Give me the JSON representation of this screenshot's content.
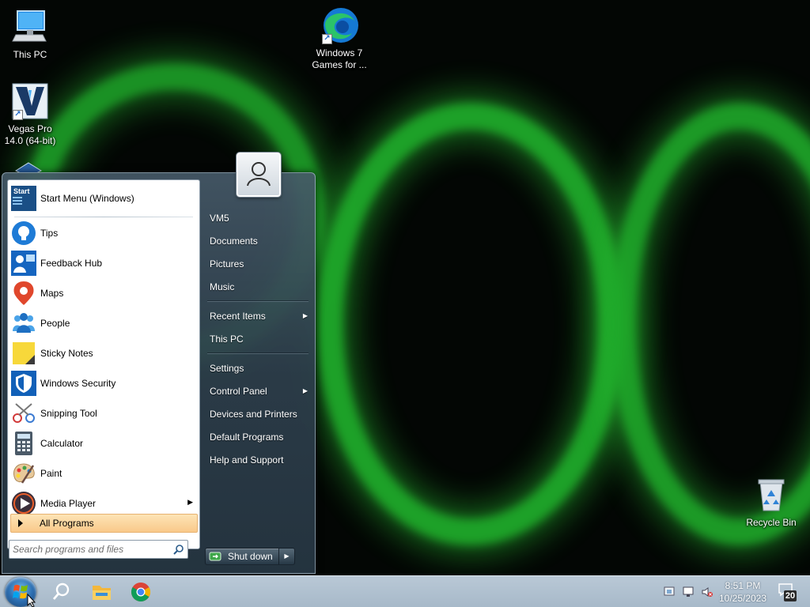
{
  "desktop": {
    "icons": [
      {
        "label": "This PC",
        "icon": "computer-icon"
      },
      {
        "label": "Windows 7 Games for ...",
        "icon": "edge-icon"
      },
      {
        "label": "Vegas Pro 14.0 (64-bit)",
        "icon": "vegas-icon"
      },
      {
        "label": "Recycle Bin",
        "icon": "recycle-bin-icon"
      }
    ]
  },
  "start_menu": {
    "pinned": [
      {
        "label": "Start Menu (Windows)",
        "icon": "start-menu-app-icon"
      },
      {
        "label": "Tips",
        "icon": "lightbulb-icon"
      },
      {
        "label": "Feedback Hub",
        "icon": "feedback-hub-icon"
      },
      {
        "label": "Maps",
        "icon": "maps-pin-icon"
      },
      {
        "label": "People",
        "icon": "people-icon"
      },
      {
        "label": "Sticky Notes",
        "icon": "sticky-notes-icon"
      },
      {
        "label": "Windows Security",
        "icon": "shield-icon"
      },
      {
        "label": "Snipping Tool",
        "icon": "scissors-icon"
      },
      {
        "label": "Calculator",
        "icon": "calculator-icon"
      },
      {
        "label": "Paint",
        "icon": "paint-palette-icon"
      },
      {
        "label": "Media Player",
        "icon": "media-player-icon"
      }
    ],
    "start_icon_text": "Start",
    "all_programs": "All Programs",
    "search_placeholder": "Search programs and files",
    "right_items": [
      {
        "label": "VM5"
      },
      {
        "label": "Documents"
      },
      {
        "label": "Pictures"
      },
      {
        "label": "Music"
      },
      {
        "label": "Recent Items",
        "submenu": true
      },
      {
        "label": "This PC"
      },
      {
        "label": "Settings"
      },
      {
        "label": "Control Panel",
        "submenu": true
      },
      {
        "label": "Devices and Printers"
      },
      {
        "label": "Default Programs"
      },
      {
        "label": "Help and Support"
      }
    ],
    "shutdown": "Shut down"
  },
  "taskbar": {
    "time": "8:51 PM",
    "date": "10/25/2023",
    "notification_count": "20",
    "pinned": [
      "search-icon",
      "file-explorer-icon",
      "chrome-icon"
    ]
  },
  "colors": {
    "accent_highlight": "#f9c98a",
    "menu_dark": "#2d3e4b",
    "taskbar": "#b3c3d2"
  }
}
